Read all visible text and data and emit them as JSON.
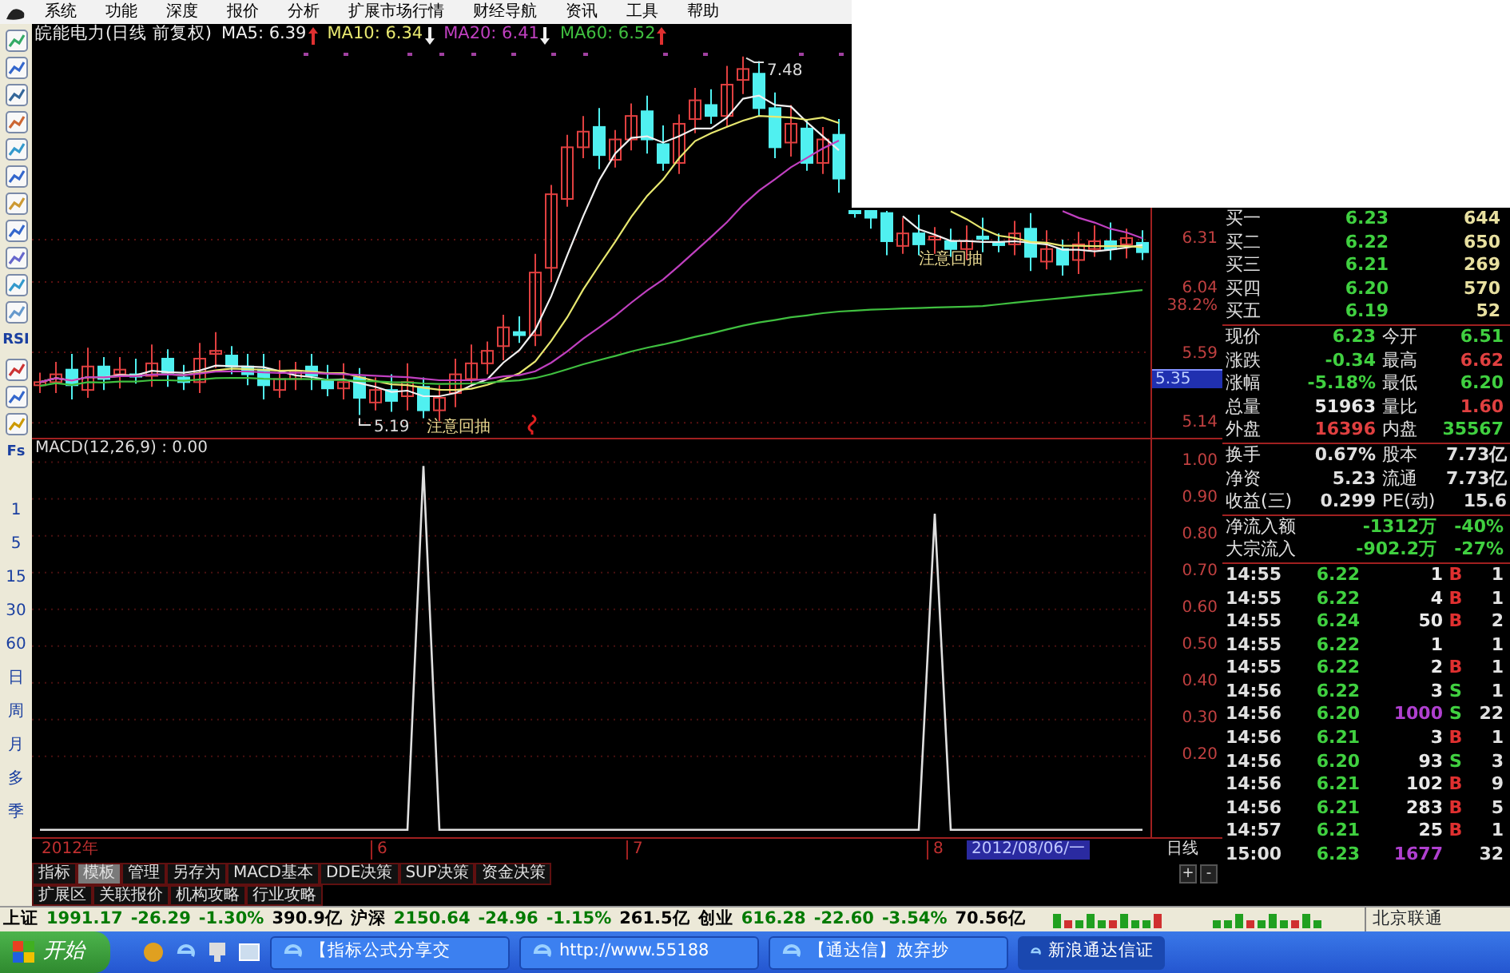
{
  "menu": {
    "items": [
      "系统",
      "功能",
      "深度",
      "报价",
      "分析",
      "扩展市场行情",
      "财经导航",
      "资讯",
      "工具",
      "帮助"
    ]
  },
  "toolbar": {
    "tools": [
      {
        "kind": "icon"
      },
      {
        "kind": "icon"
      },
      {
        "kind": "icon"
      },
      {
        "kind": "icon"
      },
      {
        "kind": "icon"
      },
      {
        "kind": "icon"
      },
      {
        "kind": "icon"
      },
      {
        "kind": "icon"
      },
      {
        "kind": "icon"
      },
      {
        "kind": "icon"
      },
      {
        "kind": "icon"
      },
      {
        "kind": "text",
        "label": "RSI"
      },
      {
        "kind": "icon"
      },
      {
        "kind": "icon"
      },
      {
        "kind": "icon"
      },
      {
        "kind": "text",
        "label": "Fs"
      }
    ],
    "periods": [
      "1",
      "5",
      "15",
      "30",
      "60",
      "日",
      "周",
      "月",
      "多",
      "季"
    ]
  },
  "price_chart": {
    "title": "皖能电力(日线 前复权)",
    "indicators": [
      {
        "label": "MA5: 6.39",
        "rising": true,
        "color": "#f0f0f0"
      },
      {
        "label": "MA10: 6.34",
        "rising": false,
        "color": "#e8e870"
      },
      {
        "label": "MA20: 6.41",
        "rising": false,
        "color": "#c040c0"
      },
      {
        "label": "MA60: 6.52",
        "rising": true,
        "color": "#40c040"
      }
    ],
    "annotations": [
      {
        "kind": "high",
        "label": "7.48"
      },
      {
        "kind": "low",
        "label": "5.19"
      },
      {
        "kind": "note",
        "label": "注意回抽"
      },
      {
        "kind": "note",
        "label": "注意回抽"
      }
    ],
    "axis_labels": [
      {
        "kind": "price",
        "label": "6.31"
      },
      {
        "kind": "price",
        "label": "6.04"
      },
      {
        "kind": "ratio",
        "label": "38.2%"
      },
      {
        "kind": "price",
        "label": "5.59"
      },
      {
        "kind": "current",
        "label": "5.35"
      },
      {
        "kind": "price",
        "label": "5.14"
      }
    ]
  },
  "macd_panel": {
    "chart_data": {
      "type": "line",
      "title": "MACD(12,26,9) : 0.00",
      "ylim": [
        -0.02,
        1.01
      ],
      "grid": true,
      "yticks": [
        {
          "value": 0.2,
          "label": "0.20"
        },
        {
          "value": 0.3,
          "label": "0.30"
        },
        {
          "value": 0.4,
          "label": "0.40"
        },
        {
          "value": 0.5,
          "label": "0.50"
        },
        {
          "value": 0.6,
          "label": "0.60"
        },
        {
          "value": 0.7,
          "label": "0.70"
        },
        {
          "value": 0.8,
          "label": "0.80"
        },
        {
          "value": 0.9,
          "label": "0.90"
        },
        {
          "value": 1.0,
          "label": "1.00"
        }
      ],
      "series": [
        {
          "color": "#e0e0e0",
          "values": [
            0,
            0,
            0,
            0,
            0,
            0,
            0,
            0,
            0,
            0,
            0,
            0,
            0,
            0,
            0,
            0,
            0,
            0,
            0,
            0,
            0,
            0,
            0,
            0,
            0.99,
            0,
            0,
            0,
            0,
            0,
            0,
            0,
            0,
            0,
            0,
            0,
            0,
            0,
            0,
            0,
            0,
            0,
            0,
            0,
            0,
            0,
            0,
            0,
            0,
            0,
            0,
            0,
            0,
            0,
            0,
            0,
            0.86,
            0,
            0,
            0,
            0,
            0,
            0,
            0,
            0,
            0,
            0,
            0,
            0,
            0
          ]
        }
      ]
    }
  },
  "date_bar": {
    "labels": [
      {
        "kind": "year",
        "label": "2012年"
      },
      {
        "kind": "month",
        "label": "6"
      },
      {
        "kind": "month",
        "label": "7"
      },
      {
        "kind": "month",
        "label": "8"
      }
    ],
    "date": "2012/08/06/一",
    "period": "日线"
  },
  "tabs": [
    {
      "label": "指标",
      "selected": false
    },
    {
      "label": "模板",
      "selected": true
    },
    {
      "label": "管理",
      "selected": false
    },
    {
      "label": "另存为",
      "selected": false
    },
    {
      "label": "MACD基本",
      "selected": false
    },
    {
      "label": "DDE决策",
      "selected": false
    },
    {
      "label": "SUP决策",
      "selected": false
    },
    {
      "label": "资金决策",
      "selected": false
    }
  ],
  "zoom_buttons": [
    "+",
    "-"
  ],
  "extra_tabs": [
    "扩展区",
    "关联报价",
    "机构攻略",
    "行业攻略"
  ],
  "order_book": [
    {
      "label": "买一",
      "price": "6.23",
      "volume": "644"
    },
    {
      "label": "买二",
      "price": "6.22",
      "volume": "650"
    },
    {
      "label": "买三",
      "price": "6.21",
      "volume": "269"
    },
    {
      "label": "买四",
      "price": "6.20",
      "volume": "570"
    },
    {
      "label": "买五",
      "price": "6.19",
      "volume": "52"
    }
  ],
  "quote": [
    {
      "cells": [
        {
          "label": "现价",
          "value": "6.23",
          "color": "#40d040"
        },
        {
          "label": "今开",
          "value": "6.51",
          "color": "#40d040"
        }
      ]
    },
    {
      "cells": [
        {
          "label": "涨跌",
          "value": "-0.34",
          "color": "#40d040"
        },
        {
          "label": "最高",
          "value": "6.62",
          "color": "#e04040"
        }
      ]
    },
    {
      "cells": [
        {
          "label": "涨幅",
          "value": "-5.18%",
          "color": "#40d040"
        },
        {
          "label": "最低",
          "value": "6.20",
          "color": "#40d040"
        }
      ]
    },
    {
      "cells": [
        {
          "label": "总量",
          "value": "51963",
          "color": "#e8e8e8"
        },
        {
          "label": "量比",
          "value": "1.60",
          "color": "#e04040"
        }
      ]
    },
    {
      "cells": [
        {
          "label": "外盘",
          "value": "16396",
          "color": "#e04040"
        },
        {
          "label": "内盘",
          "value": "35567",
          "color": "#40d040"
        }
      ]
    }
  ],
  "stats": [
    {
      "label": "换手",
      "value": "0.67%",
      "label_2": "股本",
      "value_2": "7.73亿"
    },
    {
      "label": "净资",
      "value": "5.23",
      "label_2": "流通",
      "value_2": "7.73亿"
    },
    {
      "label": "收益(三)",
      "value": "0.299",
      "label_2": "PE(动)",
      "value_2": "15.6"
    }
  ],
  "fund_flow": [
    {
      "label": "净流入额",
      "value": "-1312万",
      "percent": "-40%"
    },
    {
      "label": "大宗流入",
      "value": "-902.2万",
      "percent": "-27%"
    }
  ],
  "ticks": [
    {
      "time": "14:55",
      "price": "6.22",
      "volume": "1",
      "side": "B",
      "count": "1",
      "color": "#e8e8e8"
    },
    {
      "time": "14:55",
      "price": "6.22",
      "volume": "4",
      "side": "B",
      "count": "1",
      "color": "#e8e8e8"
    },
    {
      "time": "14:55",
      "price": "6.24",
      "volume": "50",
      "side": "B",
      "count": "2",
      "color": "#e8e8e8"
    },
    {
      "time": "14:55",
      "price": "6.22",
      "volume": "1",
      "count": "1",
      "color": "#e8e8e8"
    },
    {
      "time": "14:55",
      "price": "6.22",
      "volume": "2",
      "side": "B",
      "count": "1",
      "color": "#e8e8e8"
    },
    {
      "time": "14:56",
      "price": "6.22",
      "volume": "3",
      "side": "S",
      "count": "1",
      "color": "#e8e8e8"
    },
    {
      "time": "14:56",
      "price": "6.20",
      "volume": "1000",
      "side": "S",
      "count": "22",
      "color": "#b040d0"
    },
    {
      "time": "14:56",
      "price": "6.21",
      "volume": "3",
      "side": "B",
      "count": "1",
      "color": "#e8e8e8"
    },
    {
      "time": "14:56",
      "price": "6.20",
      "volume": "93",
      "side": "S",
      "count": "3",
      "color": "#e8e8e8"
    },
    {
      "time": "14:56",
      "price": "6.21",
      "volume": "102",
      "side": "B",
      "count": "9",
      "color": "#e8e8e8"
    },
    {
      "time": "14:56",
      "price": "6.21",
      "volume": "283",
      "side": "B",
      "count": "5",
      "color": "#e8e8e8"
    },
    {
      "time": "14:57",
      "price": "6.21",
      "volume": "25",
      "side": "B",
      "count": "1",
      "color": "#e8e8e8"
    },
    {
      "time": "15:00",
      "price": "6.23",
      "volume": "1677",
      "count": "32",
      "color": "#b040d0"
    }
  ],
  "status_bar": {
    "segments": [
      {
        "text": "上证",
        "color": "#000000"
      },
      {
        "text": "1991.17",
        "color": "#007a00"
      },
      {
        "text": "-26.29",
        "color": "#007a00"
      },
      {
        "text": "-1.30%",
        "color": "#007a00"
      },
      {
        "text": "390.9亿",
        "color": "#000000"
      },
      {
        "text": "沪深",
        "color": "#000000"
      },
      {
        "text": "2150.64",
        "color": "#007a00"
      },
      {
        "text": "-24.96",
        "color": "#007a00"
      },
      {
        "text": "-1.15%",
        "color": "#007a00"
      },
      {
        "text": "261.5亿",
        "color": "#000000"
      },
      {
        "text": "创业",
        "color": "#000000"
      },
      {
        "text": "616.28",
        "color": "#007a00"
      },
      {
        "text": "-22.60",
        "color": "#007a00"
      },
      {
        "text": "-3.54%",
        "color": "#007a00"
      },
      {
        "text": "70.56亿",
        "color": "#000000"
      }
    ],
    "server": "北京联通"
  },
  "taskbar": {
    "start": "开始",
    "windows": [
      {
        "label": "【指标公式分享交",
        "selected": false
      },
      {
        "label": "http://www.55188",
        "selected": false
      },
      {
        "label": "【通达信】放弃抄",
        "selected": false
      },
      {
        "label": "新浪通达信证",
        "selected": true
      }
    ]
  }
}
